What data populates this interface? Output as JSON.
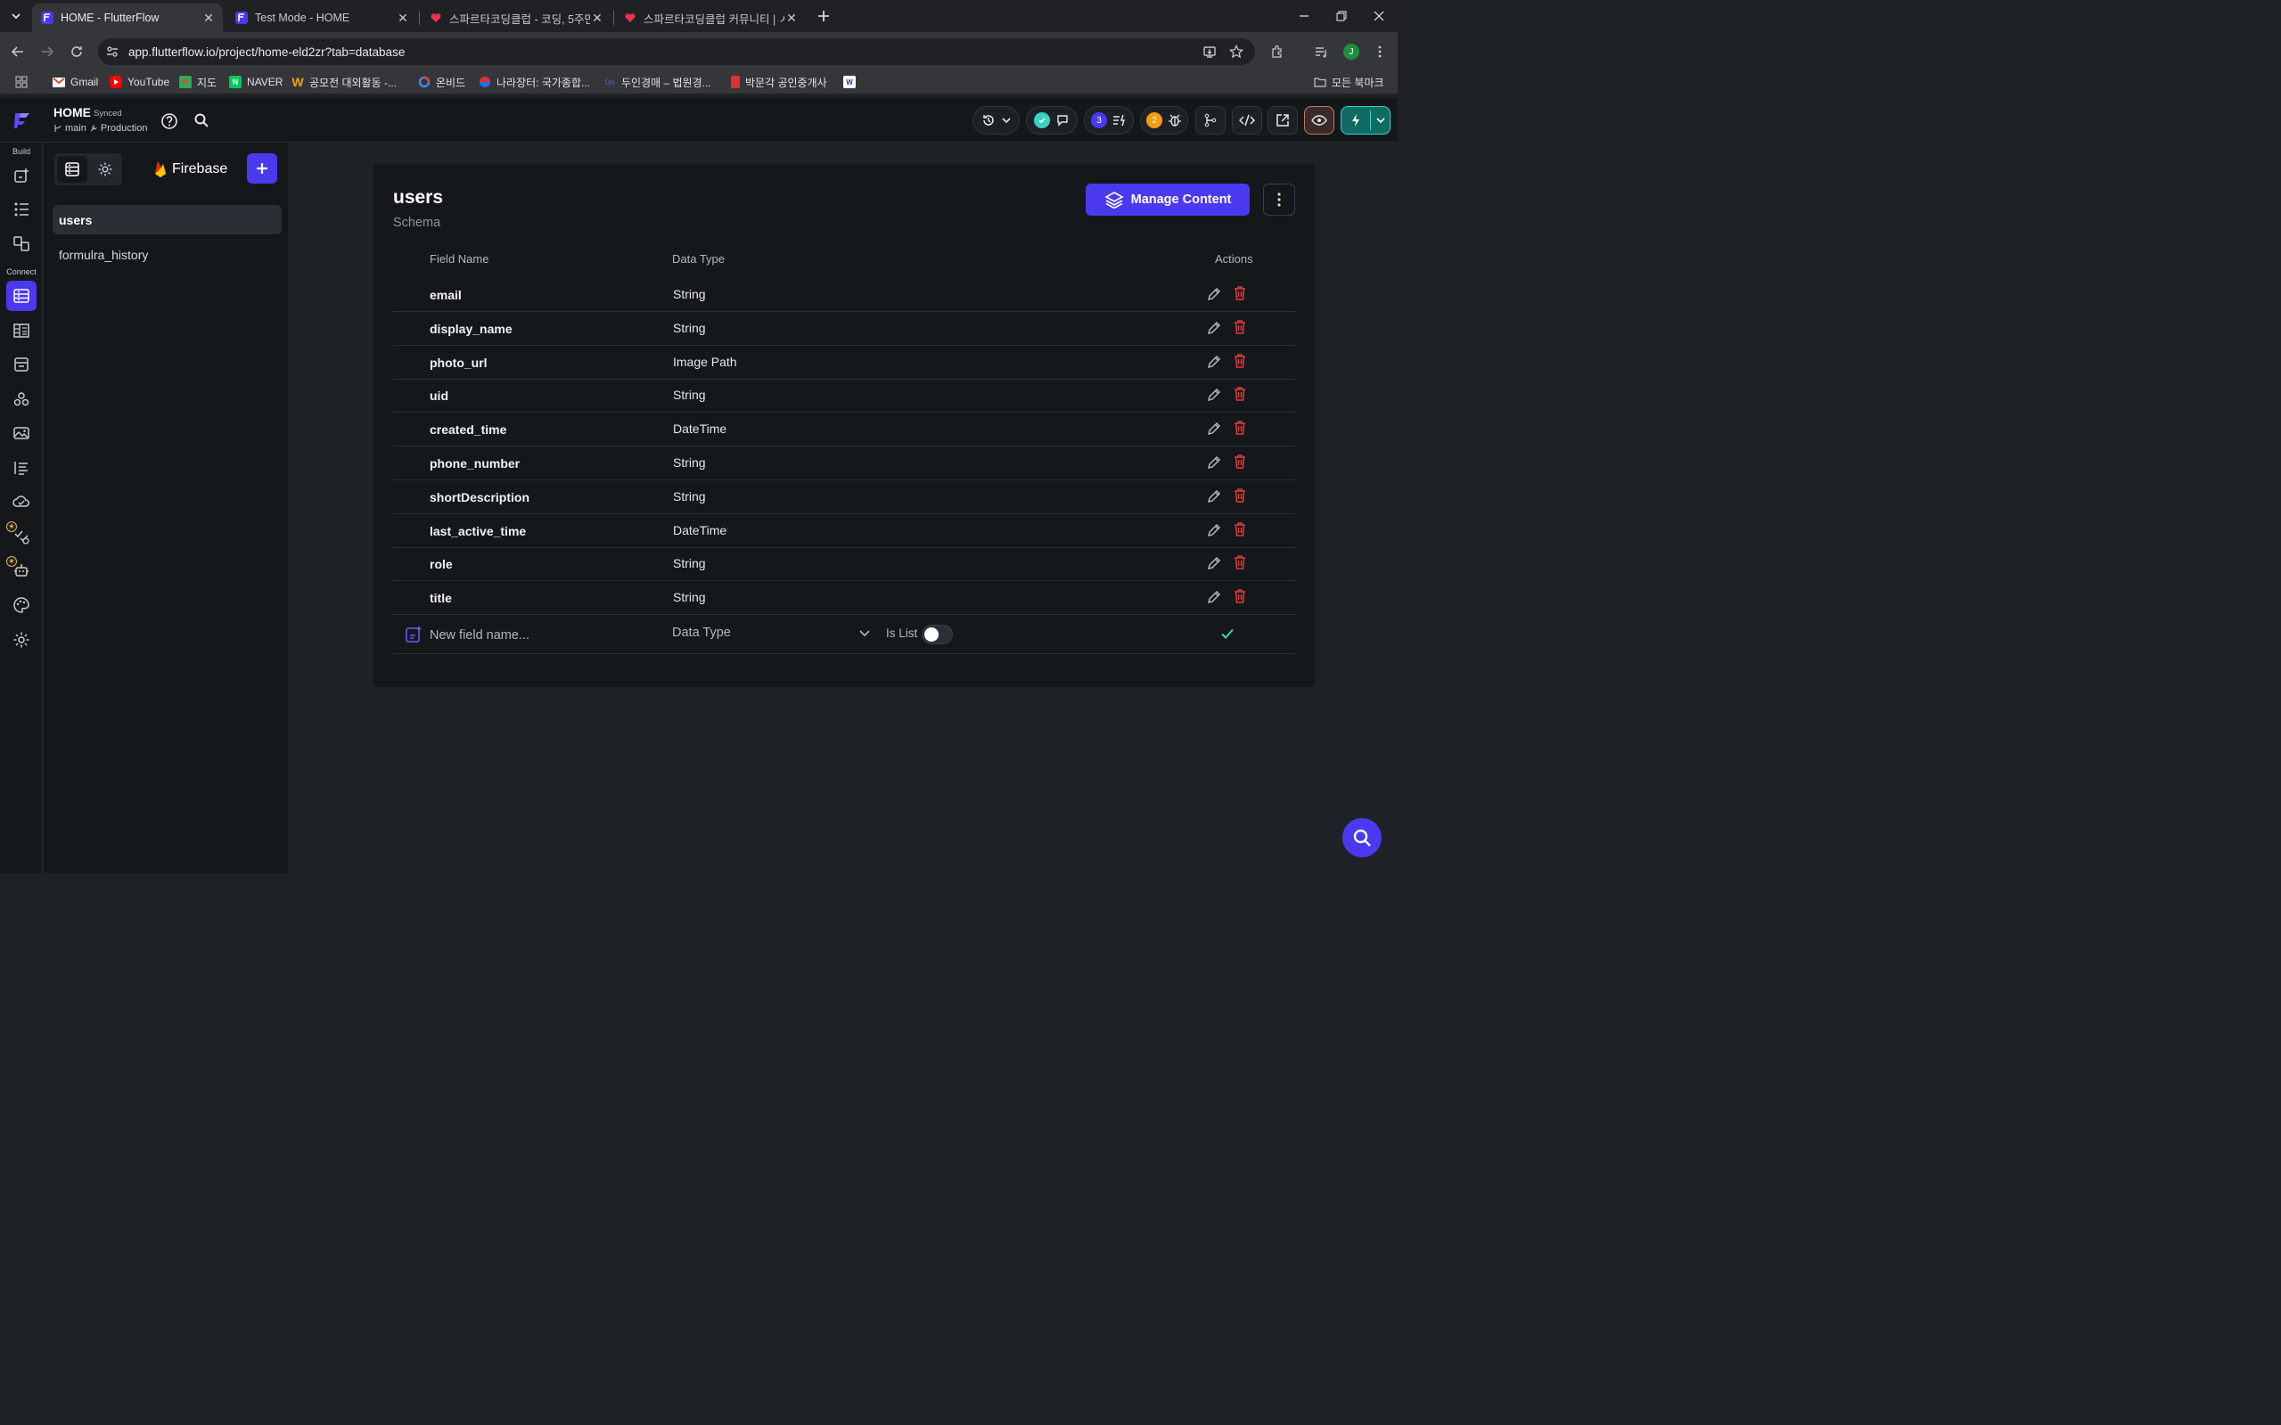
{
  "browser": {
    "tabs": [
      {
        "title": "HOME - FlutterFlow",
        "active": true
      },
      {
        "title": "Test Mode - HOME",
        "active": false
      },
      {
        "title": "스파르타코딩클럽 - 코딩, 5주만",
        "active": false
      },
      {
        "title": "스파르타코딩클럽 커뮤니티 | ㅅ",
        "active": false
      }
    ],
    "url": "app.flutterflow.io/project/home-eld2zr?tab=database",
    "profile_initial": "J",
    "bookmarks": [
      {
        "label": "Gmail",
        "color": "#ea4335"
      },
      {
        "label": "YouTube",
        "color": "#ff0000"
      },
      {
        "label": "지도",
        "color": "#34a853"
      },
      {
        "label": "NAVER",
        "color": "#03c75a"
      },
      {
        "label": "공모전 대외활동 -...",
        "color": "#f0a30a"
      },
      {
        "label": "온비드",
        "color": "#4285f4"
      },
      {
        "label": "나라장터: 국가종합...",
        "color": "#1a73e8"
      },
      {
        "label": "두인경매 – 법원경...",
        "color": "#3b5bdb"
      },
      {
        "label": "박문각 공인중개사",
        "color": "#e03131"
      }
    ],
    "all_bookmarks": "모든 북마크"
  },
  "app": {
    "project_name": "HOME",
    "sync_status": "Synced",
    "branch": "main",
    "environment": "Production",
    "header_badges": {
      "comments_count": "3",
      "issues_count": "2"
    },
    "accent": "#4b39ef"
  },
  "rail": {
    "build_label": "Build",
    "connect_label": "Connect"
  },
  "panel": {
    "firebase_label": "Firebase",
    "collections": [
      {
        "name": "users",
        "active": true
      },
      {
        "name": "formulra_history",
        "active": false
      }
    ]
  },
  "schema": {
    "collection": "users",
    "subtitle": "Schema",
    "manage_label": "Manage Content",
    "headers": {
      "field": "Field Name",
      "type": "Data Type",
      "actions": "Actions"
    },
    "fields": [
      {
        "name": "email",
        "type": "String"
      },
      {
        "name": "display_name",
        "type": "String"
      },
      {
        "name": "photo_url",
        "type": "Image Path"
      },
      {
        "name": "uid",
        "type": "String"
      },
      {
        "name": "created_time",
        "type": "DateTime"
      },
      {
        "name": "phone_number",
        "type": "String"
      },
      {
        "name": "shortDescription",
        "type": "String"
      },
      {
        "name": "last_active_time",
        "type": "DateTime"
      },
      {
        "name": "role",
        "type": "String"
      },
      {
        "name": "title",
        "type": "String"
      }
    ],
    "new_field": {
      "placeholder": "New field name...",
      "type_placeholder": "Data Type",
      "is_list_label": "Is List",
      "is_list": false
    }
  }
}
